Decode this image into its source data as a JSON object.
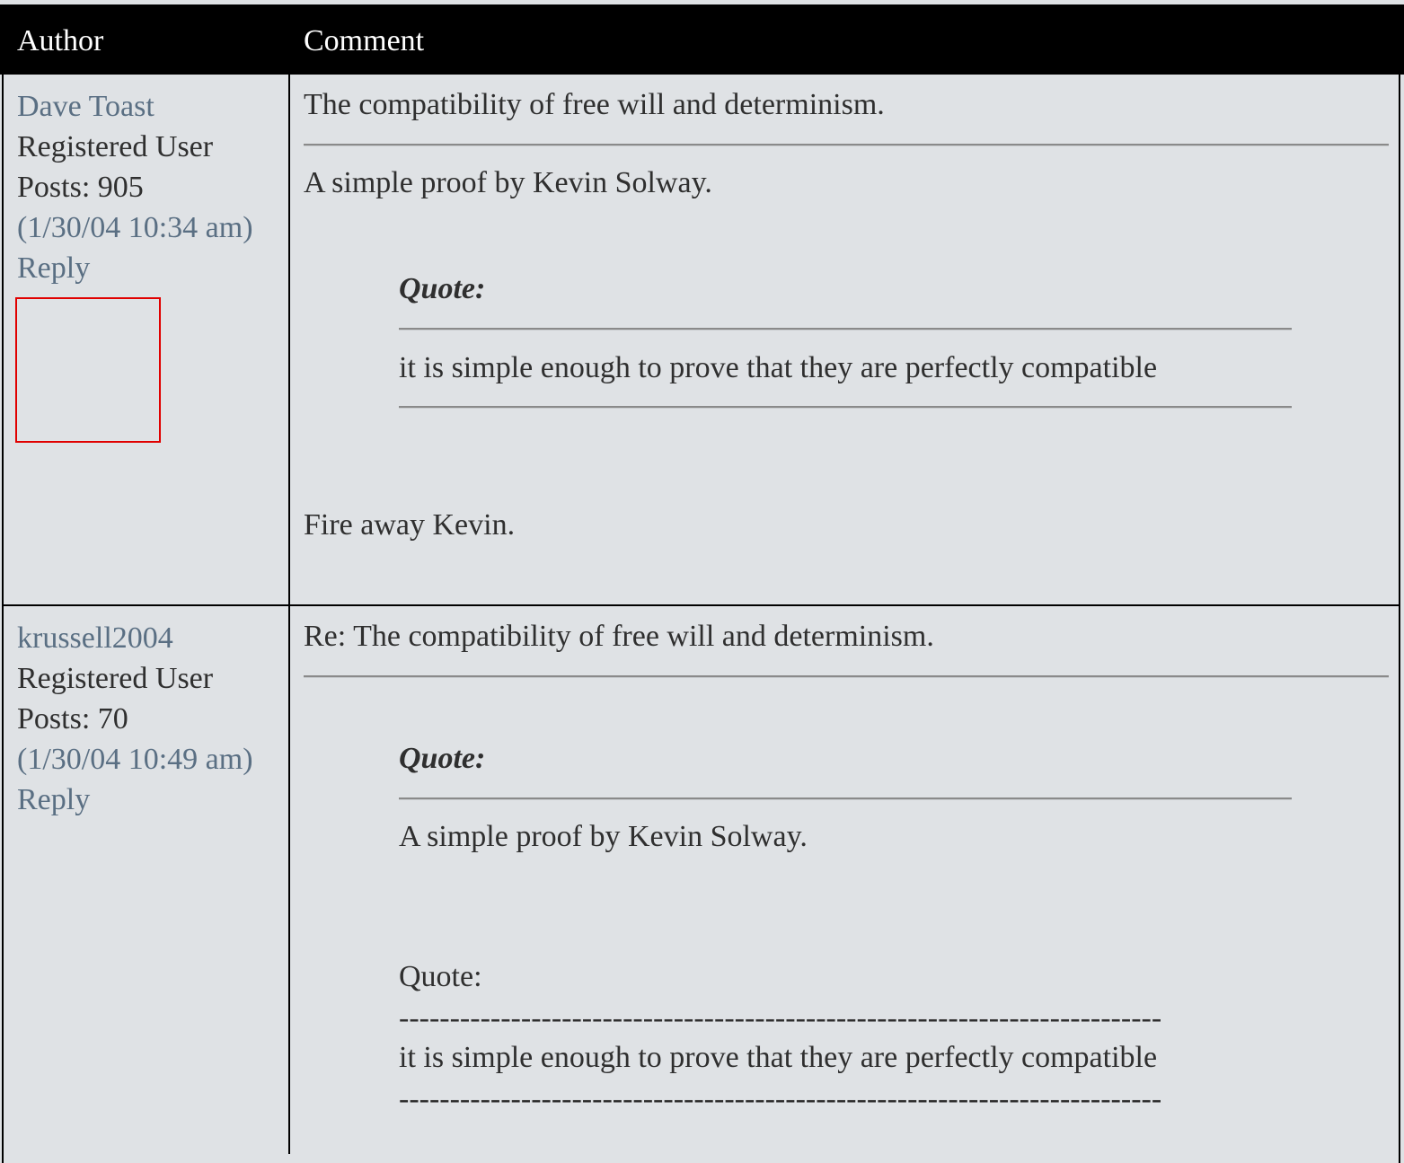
{
  "header": {
    "author": "Author",
    "comment": "Comment"
  },
  "posts": [
    {
      "author": {
        "name": "Dave Toast",
        "role": "Registered User",
        "posts": "Posts: 905",
        "timestamp": "(1/30/04 10:34 am)",
        "reply": "Reply"
      },
      "subject": "The compatibility of free will and determinism.",
      "intro": "A simple proof by Kevin Solway.",
      "quote": {
        "label": "Quote:",
        "text": "it is simple enough to prove that they are perfectly compatible"
      },
      "closing": "Fire away Kevin."
    },
    {
      "author": {
        "name": "krussell2004",
        "role": "Registered User",
        "posts": "Posts: 70",
        "timestamp": "(1/30/04 10:49 am)",
        "reply": "Reply"
      },
      "subject": "Re: The compatibility of free will and determinism.",
      "quote": {
        "label": "Quote:",
        "text": "A simple proof by Kevin Solway.",
        "inner_label": "Quote:",
        "dashes": "---------------------------------------------------------------------------",
        "inner_text": "it is simple enough to prove that they are perfectly compatible"
      }
    }
  ]
}
